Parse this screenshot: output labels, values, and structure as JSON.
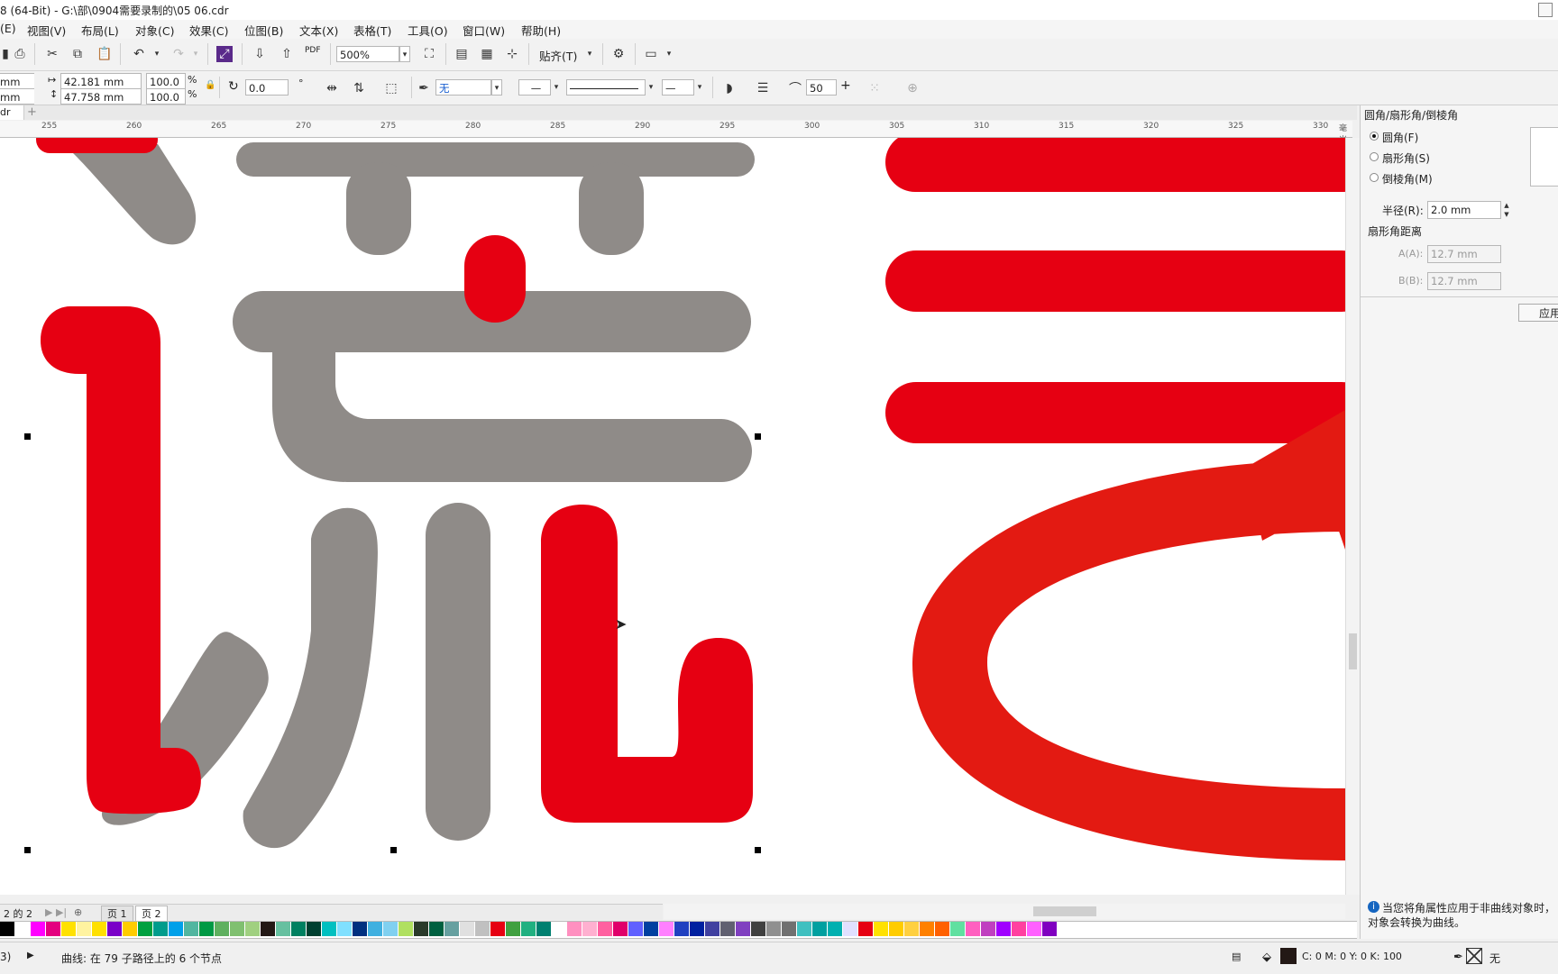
{
  "window": {
    "title": "8 (64-Bit) - G:\\部\\0904需要录制的\\05 06.cdr"
  },
  "menu": [
    "(E)",
    "视图(V)",
    "布局(L)",
    "对象(C)",
    "效果(C)",
    "位图(B)",
    "文本(X)",
    "表格(T)",
    "工具(O)",
    "窗口(W)",
    "帮助(H)"
  ],
  "toolbar1": {
    "zoom": "500%",
    "snap": "贴齐(T)",
    "pdf": "PDF"
  },
  "toolbar2": {
    "x_unit": "mm",
    "y_unit": "mm",
    "width": "42.181 mm",
    "height": "47.758 mm",
    "scale_x": "100.0",
    "scale_y": "100.0",
    "percent": "%",
    "angle": "0.0",
    "degree": "°",
    "fill": "无",
    "outline_value": "50"
  },
  "doc": {
    "tab": "dr",
    "add": "+"
  },
  "ruler": {
    "labels": [
      "255",
      "260",
      "265",
      "270",
      "275",
      "280",
      "285",
      "290",
      "295",
      "300",
      "305",
      "310",
      "315",
      "320",
      "325",
      "330"
    ],
    "unit": "毫米"
  },
  "docker": {
    "title": "圆角/扇形角/倒棱角",
    "opt_round": "圆角(F)",
    "opt_scallop": "扇形角(S)",
    "opt_chamfer": "倒棱角(M)",
    "radius_label": "半径(R):",
    "radius_value": "2.0 mm",
    "distance_label": "扇形角距离",
    "a_label": "A(A):",
    "a_value": "12.7 mm",
    "b_label": "B(B):",
    "b_value": "12.7 mm",
    "apply": "应用",
    "hint": "当您将角属性应用于非曲线对象时，对象会转换为曲线。"
  },
  "pages": {
    "counter": "2 的 2",
    "page1": "页 1",
    "page2": "页 2"
  },
  "palette": [
    "#000000",
    "#ffffff",
    "#ff00ff",
    "#e4007f",
    "#ffe100",
    "#fff3a0",
    "#ffe000",
    "#7a00c8",
    "#ffcc00",
    "#00a040",
    "#009c8c",
    "#00a0e9",
    "#52b6a0",
    "#009944",
    "#5fb05f",
    "#80c070",
    "#a0d080",
    "#231815",
    "#66c0a0",
    "#008060",
    "#004030",
    "#00c0c0",
    "#80e0ff",
    "#003080",
    "#40b0e0",
    "#80d0f0",
    "#b0e060",
    "#2a3a2a",
    "#006040",
    "#66a0a0",
    "#e0e0e0",
    "#c0c0c0",
    "#e60012",
    "#40a040",
    "#20b080",
    "#008070",
    "#ffffff",
    "#ff90c0",
    "#ffb0d0",
    "#ff60a0",
    "#e0006a",
    "#6060ff",
    "#0040a0",
    "#ff80ff",
    "#2040c0",
    "#0020a0",
    "#4040a0",
    "#606070",
    "#8040c0",
    "#404040",
    "#909090",
    "#707070",
    "#40c0c0",
    "#00a0a0",
    "#00b0b0",
    "#e0e0ff",
    "#e60012",
    "#ffe100",
    "#ffcc00",
    "#ffd040",
    "#ff8000",
    "#ff6000",
    "#60e0a0",
    "#ff60c0",
    "#c040c0",
    "#a000ff",
    "#ff40a0",
    "#ff60ff",
    "#8000c0"
  ],
  "status": {
    "left": "3)",
    "info": "曲线: 在 79 子路径上的 6 个节点",
    "color": "C: 0 M: 0 Y: 0 K: 100",
    "outline": "无"
  }
}
